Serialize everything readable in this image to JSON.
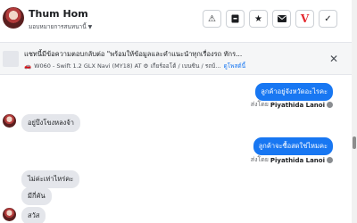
{
  "header": {
    "name": "Thum Hom",
    "subtitle": "มอบหมายการสนทนานี้",
    "toolbar_icons": [
      "warning-icon",
      "archive-icon",
      "star-icon",
      "email-icon",
      "brand-v-icon",
      "check-icon"
    ]
  },
  "notice": {
    "title": "แชทนี้มีข้อความตอบกลับต่อ \"พร้อมให้ข้อมูลและคำแนะนำทุกเรื่องรถ ทักร...",
    "car": "🚗",
    "detail": "W060 - Swift 1.2 GLX Navi (MY18) AT ⚙ เกียร์ออโต้ / เบนซิน / รถบ้...",
    "link": "ดูโพสต์นี้"
  },
  "messages": [
    {
      "dir": "out",
      "text": "ลูกค้าอยู่จังหวัดอะไรคะ"
    },
    {
      "dir": "meta",
      "prefix": "ส่งโดย",
      "sender": "Piyathida Lanoi"
    },
    {
      "dir": "in",
      "text": "อยู่บึงโขงหลงจ้า"
    },
    {
      "dir": "out",
      "text": "ลูกค้าจะซื้อสดใช่ไหมคะ"
    },
    {
      "dir": "meta",
      "prefix": "ส่งโดย",
      "sender": "Piyathida Lanoi"
    },
    {
      "dir": "in",
      "text": "ไม่ค่ะเท่าไหร่คะ"
    },
    {
      "dir": "in",
      "text": "มีกี่คัน"
    },
    {
      "dir": "in",
      "text": "สวัส"
    }
  ],
  "colors": {
    "outgoing_bubble": "#1877f2",
    "incoming_bubble": "#e4e6eb",
    "link": "#1877f2"
  }
}
